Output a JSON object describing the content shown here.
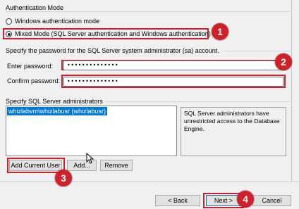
{
  "auth_mode": {
    "legend": "Authentication Mode",
    "options": [
      {
        "label": "Windows authentication mode",
        "selected": false
      },
      {
        "label": "Mixed Mode (SQL Server authentication and Windows authentication)",
        "selected": true
      }
    ]
  },
  "password": {
    "legend": "Specify the password for the SQL Server system administrator (sa) account.",
    "enter_label": "Enter password:",
    "enter_value": "••••••••••••••",
    "confirm_label": "Confirm password:",
    "confirm_value": "••••••••••••••"
  },
  "admins": {
    "legend": "Specify SQL Server administrators",
    "items": [
      "whizlabvm\\whizlabusr (whizlabusr)"
    ],
    "info": "SQL Server administrators have unrestricted access to the Database Engine.",
    "add_current_user": "Add Current User",
    "add": "Add...",
    "remove": "Remove"
  },
  "footer": {
    "back": "< Back",
    "next": "Next >",
    "cancel": "Cancel"
  },
  "annotations": [
    "1",
    "2",
    "3",
    "4"
  ],
  "colors": {
    "highlight": "#d0202a",
    "selection": "#0078d7"
  }
}
